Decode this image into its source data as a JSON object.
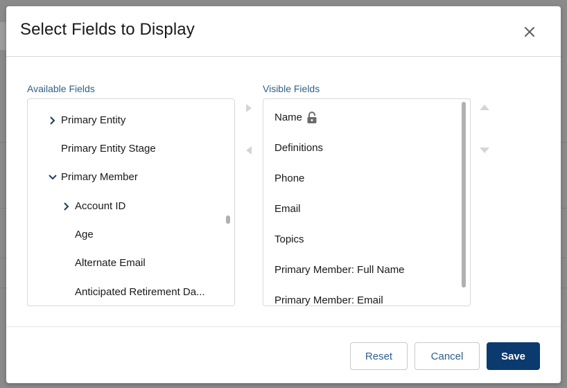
{
  "modal": {
    "title": "Select Fields to Display",
    "close_icon": "close-icon"
  },
  "available": {
    "label": "Available Fields",
    "items": [
      {
        "label": "Primary Entity",
        "expander": "chevron-right",
        "level": 0
      },
      {
        "label": "Primary Entity Stage",
        "expander": "none",
        "level": 0
      },
      {
        "label": "Primary Member",
        "expander": "chevron-down",
        "level": 0
      },
      {
        "label": "Account ID",
        "expander": "chevron-right",
        "level": 1
      },
      {
        "label": "Age",
        "expander": "none",
        "level": 1
      },
      {
        "label": "Alternate Email",
        "expander": "none",
        "level": 1
      },
      {
        "label": "Anticipated Retirement Da...",
        "expander": "none",
        "level": 1
      }
    ]
  },
  "visible": {
    "label": "Visible Fields",
    "items": [
      {
        "label": "Name",
        "icon": "lock-icon"
      },
      {
        "label": "Definitions"
      },
      {
        "label": "Phone"
      },
      {
        "label": "Email"
      },
      {
        "label": "Topics"
      },
      {
        "label": "Primary Member: Full Name"
      },
      {
        "label": "Primary Member: Email"
      }
    ]
  },
  "move_controls": {
    "to_visible": "arrow-right-icon",
    "to_available": "arrow-left-icon",
    "move_up": "arrow-up-icon",
    "move_down": "arrow-down-icon"
  },
  "footer": {
    "reset_label": "Reset",
    "cancel_label": "Cancel",
    "save_label": "Save"
  },
  "colors": {
    "brand": "#0b3a6e",
    "link": "#2e5f8a",
    "border": "#d8d8d8"
  }
}
